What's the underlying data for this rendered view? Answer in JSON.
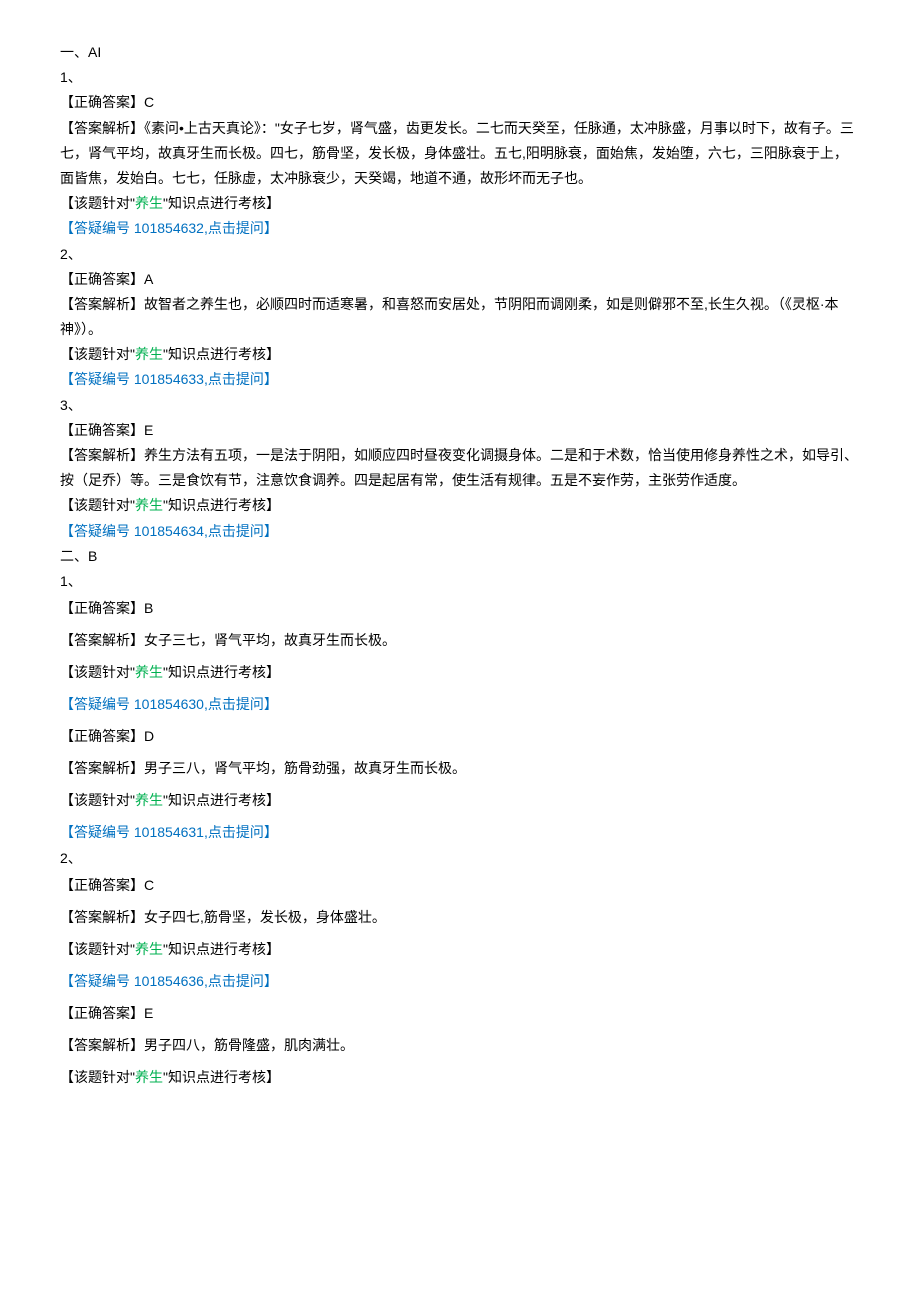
{
  "a": {
    "header": "一、AI",
    "q1": {
      "num": "1、",
      "ans_label": "【正确答案】",
      "ans": "C",
      "exp_label": "【答案解析】",
      "exp": "《素问•上古天真论》：\"女子七岁，肾气盛，齿更发长。二七而天癸至，任脉通，太冲脉盛，月事以时下，故有子。三七，肾气平均，故真牙生而长极。四七，筋骨坚，发长极，身体盛壮。五七,阳明脉衰，面始焦，发始堕，六七，三阳脉衰于上，面皆焦，发始白。七七，任脉虚，太冲脉衰少，天癸竭，地道不通，故形坏而无子也。",
      "note_pre": "【该题针对\"",
      "note_kw": "养生",
      "note_post": "\"知识点进行考核】",
      "link_pre": "【答疑编号 ",
      "link_id": "101854632",
      "link_post": ",点击提问】"
    },
    "q2": {
      "num": "2、",
      "ans_label": "【正确答案】",
      "ans": "A",
      "exp_label": "【答案解析】",
      "exp": "故智者之养生也，必顺四时而适寒暑，和喜怒而安居处，节阴阳而调刚柔，如是则僻邪不至,长生久视。（《灵枢·本神》）。",
      "note_pre": "【该题针对\"",
      "note_kw": "养生",
      "note_post": "\"知识点进行考核】",
      "link_pre": "【答疑编号 ",
      "link_id": "101854633",
      "link_post": ",点击提问】"
    },
    "q3": {
      "num": "3、",
      "ans_label": "【正确答案】",
      "ans": "E",
      "exp_label": "【答案解析】",
      "exp": "养生方法有五项，一是法于阴阳，如顺应四时昼夜变化调摄身体。二是和于术数，恰当使用修身养性之术，如导引、按（足乔）等。三是食饮有节，注意饮食调养。四是起居有常，使生活有规律。五是不妄作劳，主张劳作适度。",
      "note_pre": "【该题针对\"",
      "note_kw": "养生",
      "note_post": "\"知识点进行考核】",
      "link_pre": "【答疑编号 ",
      "link_id": "101854634",
      "link_post": ",点击提问】"
    }
  },
  "b": {
    "header": "二、B",
    "q1": {
      "num": "1、",
      "p1": {
        "ans_label": "【正确答案】",
        "ans": "B",
        "exp_label": "【答案解析】",
        "exp": "女子三七，肾气平均，故真牙生而长极。",
        "note_pre": "【该题针对\"",
        "note_kw": "养生",
        "note_post": "\"知识点进行考核】",
        "link_pre": "【答疑编号 ",
        "link_id": "101854630",
        "link_post": ",点击提问】"
      },
      "p2": {
        "ans_label": "【正确答案】",
        "ans": "D",
        "exp_label": "【答案解析】",
        "exp": "男子三八，肾气平均，筋骨劲强，故真牙生而长极。",
        "note_pre": "【该题针对\"",
        "note_kw": "养生",
        "note_post": "\"知识点进行考核】",
        "link_pre": "【答疑编号 ",
        "link_id": "101854631",
        "link_post": ",点击提问】"
      }
    },
    "q2": {
      "num": "2、",
      "p1": {
        "ans_label": "【正确答案】",
        "ans": "C",
        "exp_label": "【答案解析】",
        "exp": "女子四七,筋骨坚，发长极，身体盛壮。",
        "note_pre": "【该题针对\"",
        "note_kw": "养生",
        "note_post": "\"知识点进行考核】",
        "link_pre": "【答疑编号 ",
        "link_id": "101854636",
        "link_post": ",点击提问】"
      },
      "p2": {
        "ans_label": "【正确答案】",
        "ans": "E",
        "exp_label": "【答案解析】",
        "exp": "男子四八，筋骨隆盛，肌肉满壮。",
        "note_pre": "【该题针对\"",
        "note_kw": "养生",
        "note_post": "\"知识点进行考核】"
      }
    }
  }
}
